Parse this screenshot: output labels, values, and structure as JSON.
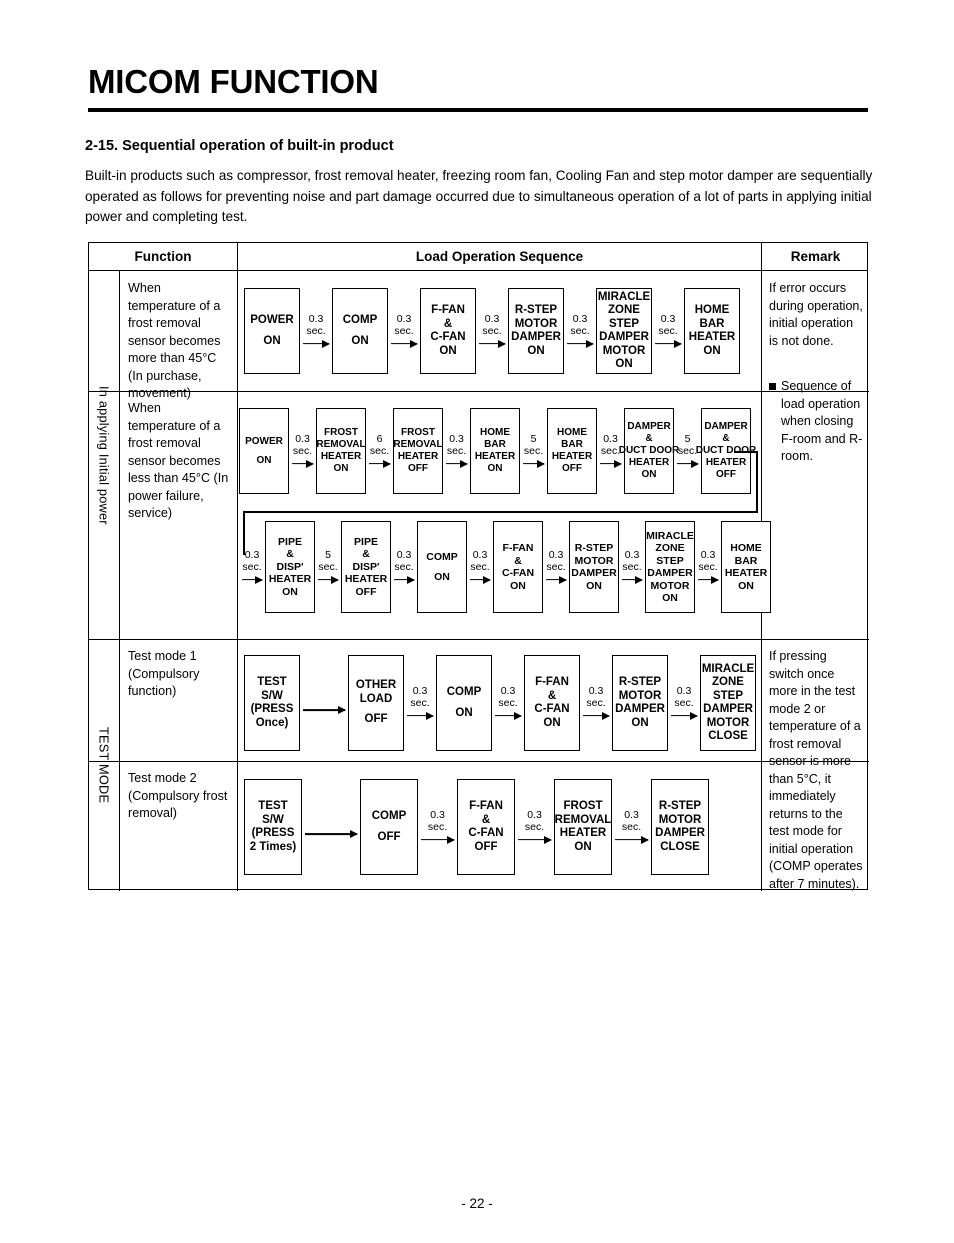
{
  "document": {
    "title": "MICOM FUNCTION",
    "section_heading": "2-15. Sequential operation of built-in product",
    "intro": "Built-in products such as compressor, frost removal heater, freezing room fan, Cooling Fan and step motor damper are sequentially operated as follows for preventing noise and part damage occurred due to simultaneous operation of a lot of parts in applying initial power and completing test.",
    "page_number": "- 22 -"
  },
  "table": {
    "headers": {
      "function": "Function",
      "sequence": "Load Operation Sequence",
      "remark": "Remark"
    },
    "groups": [
      {
        "label": "In applying Initial power"
      },
      {
        "label": "TEST MODE"
      }
    ],
    "rows": [
      {
        "function": "When temperature of a frost removal sensor becomes more than 45°C (In purchase, movement)",
        "remark_text": "If error occurs during operation, initial operation is not done.",
        "remark_bullet": "Sequence of load operation when closing F-room and R-room."
      },
      {
        "function": "When temperature of a frost removal sensor becomes less than 45°C (In power failure, service)"
      },
      {
        "function": "Test mode 1 (Compulsory function)",
        "remark_text": "If pressing switch once more in the test mode 2 or temperature of a frost removal sensor is more than 5°C, it immediately returns to the test mode for initial operation (COMP operates after 7 minutes)."
      },
      {
        "function": "Test mode 2 (Compulsory frost removal)"
      }
    ]
  },
  "flows": {
    "row1": {
      "nodes": [
        {
          "lines": [
            "POWER"
          ],
          "sub": [
            "ON"
          ]
        },
        {
          "lines": [
            "COMP"
          ],
          "sub": [
            "ON"
          ]
        },
        {
          "lines": [
            "F-FAN",
            "&",
            "C-FAN",
            "ON"
          ]
        },
        {
          "lines": [
            "R-STEP",
            "MOTOR",
            "DAMPER",
            "ON"
          ]
        },
        {
          "lines": [
            "MIRACLE",
            "ZONE",
            "STEP",
            "DAMPER",
            "MOTOR",
            "ON"
          ]
        },
        {
          "lines": [
            "HOME",
            "BAR",
            "HEATER",
            "ON"
          ]
        }
      ],
      "arrows": [
        "0.3 sec.",
        "0.3 sec.",
        "0.3 sec.",
        "0.3 sec.",
        "0.3 sec."
      ]
    },
    "row2a": {
      "nodes": [
        {
          "lines": [
            "POWER"
          ],
          "sub": [
            "ON"
          ]
        },
        {
          "lines": [
            "FROST",
            "REMOVAL",
            "HEATER",
            "ON"
          ]
        },
        {
          "lines": [
            "FROST",
            "REMOVAL",
            "HEATER",
            "OFF"
          ]
        },
        {
          "lines": [
            "HOME",
            "BAR",
            "HEATER",
            "ON"
          ]
        },
        {
          "lines": [
            "HOME",
            "BAR",
            "HEATER",
            "OFF"
          ]
        },
        {
          "lines": [
            "DAMPER",
            "&",
            "DUCT DOOR",
            "HEATER",
            "ON"
          ]
        },
        {
          "lines": [
            "DAMPER",
            "&",
            "DUCT DOOR",
            "HEATER",
            "OFF"
          ]
        }
      ],
      "arrows": [
        "0.3 sec.",
        "6 sec.",
        "0.3 sec.",
        "5 sec.",
        "0.3 sec.",
        "5 sec."
      ]
    },
    "row2b": {
      "entry_arrow": "0.3 sec.",
      "nodes": [
        {
          "lines": [
            "PIPE",
            "&",
            "DISP'",
            "HEATER",
            "ON"
          ]
        },
        {
          "lines": [
            "PIPE",
            "&",
            "DISP'",
            "HEATER",
            "OFF"
          ]
        },
        {
          "lines": [
            "COMP"
          ],
          "sub": [
            "ON"
          ]
        },
        {
          "lines": [
            "F-FAN",
            "&",
            "C-FAN",
            "ON"
          ]
        },
        {
          "lines": [
            "R-STEP",
            "MOTOR",
            "DAMPER",
            "ON"
          ]
        },
        {
          "lines": [
            "MIRACLE",
            "ZONE",
            "STEP",
            "DAMPER",
            "MOTOR",
            "ON"
          ]
        },
        {
          "lines": [
            "HOME",
            "BAR",
            "HEATER",
            "ON"
          ]
        }
      ],
      "arrows": [
        "5 sec.",
        "0.3 sec.",
        "0.3 sec.",
        "0.3 sec.",
        "0.3 sec.",
        "0.3 sec."
      ]
    },
    "row3": {
      "nodes": [
        {
          "lines": [
            "TEST",
            "S/W",
            "(PRESS",
            "Once)"
          ]
        },
        {
          "lines": [
            "OTHER",
            "LOAD"
          ],
          "sub": [
            "OFF"
          ]
        },
        {
          "lines": [
            "COMP"
          ],
          "sub": [
            "ON"
          ]
        },
        {
          "lines": [
            "F-FAN",
            "&",
            "C-FAN",
            "ON"
          ]
        },
        {
          "lines": [
            "R-STEP",
            "MOTOR",
            "DAMPER",
            "ON"
          ]
        },
        {
          "lines": [
            "MIRACLE",
            "ZONE",
            "STEP",
            "DAMPER",
            "MOTOR",
            "CLOSE"
          ]
        }
      ],
      "arrows": [
        "",
        "0.3 sec.",
        "0.3 sec.",
        "0.3 sec.",
        "0.3 sec."
      ]
    },
    "row4": {
      "nodes": [
        {
          "lines": [
            "TEST",
            "S/W",
            "(PRESS",
            "2 Times)"
          ]
        },
        {
          "lines": [
            "COMP"
          ],
          "sub": [
            "OFF"
          ]
        },
        {
          "lines": [
            "F-FAN",
            "&",
            "C-FAN",
            "OFF"
          ]
        },
        {
          "lines": [
            "FROST",
            "REMOVAL",
            "HEATER",
            "ON"
          ]
        },
        {
          "lines": [
            "R-STEP",
            "MOTOR",
            "DAMPER",
            "CLOSE"
          ]
        }
      ],
      "arrows": [
        "",
        "0.3 sec.",
        "0.3 sec.",
        "0.3 sec."
      ]
    }
  }
}
